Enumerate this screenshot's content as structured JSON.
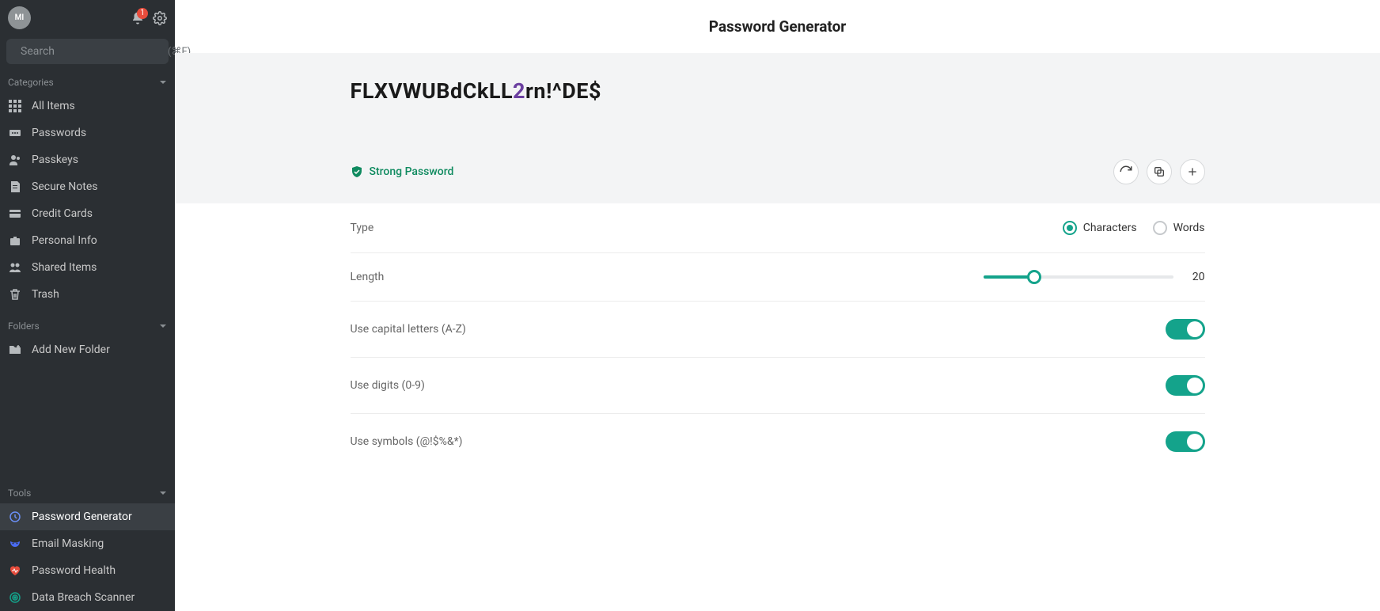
{
  "header": {
    "avatar_initials": "MI",
    "notification_count": "1",
    "search_placeholder": "Search",
    "search_hint": "(⌘F)"
  },
  "sidebar": {
    "categories_label": "Categories",
    "items": [
      {
        "label": "All Items"
      },
      {
        "label": "Passwords"
      },
      {
        "label": "Passkeys"
      },
      {
        "label": "Secure Notes"
      },
      {
        "label": "Credit Cards"
      },
      {
        "label": "Personal Info"
      },
      {
        "label": "Shared Items"
      },
      {
        "label": "Trash"
      }
    ],
    "folders_label": "Folders",
    "add_folder_label": "Add New Folder",
    "tools_label": "Tools",
    "tools": [
      {
        "label": "Password Generator"
      },
      {
        "label": "Email Masking"
      },
      {
        "label": "Password Health"
      },
      {
        "label": "Data Breach Scanner"
      }
    ]
  },
  "main": {
    "title": "Password Generator",
    "password_plain": "FLXVWUBdCkLL2rn!^DE$",
    "password_segments": [
      {
        "text": "FLXVWUBdCkLL",
        "kind": "alpha"
      },
      {
        "text": "2",
        "kind": "digit"
      },
      {
        "text": "rn",
        "kind": "alpha"
      },
      {
        "text": "!^",
        "kind": "symbol"
      },
      {
        "text": "DE",
        "kind": "alpha"
      },
      {
        "text": "$",
        "kind": "symbol"
      }
    ],
    "strength_label": "Strong Password",
    "type_label": "Type",
    "type_options": {
      "characters": "Characters",
      "words": "Words"
    },
    "type_selected": "characters",
    "length_label": "Length",
    "length_value": "20",
    "length_min": 4,
    "length_max": 64,
    "options": {
      "capitals": {
        "label": "Use capital letters (A-Z)",
        "on": true
      },
      "digits": {
        "label": "Use digits (0-9)",
        "on": true
      },
      "symbols": {
        "label": "Use symbols (@!$%&*)",
        "on": true
      }
    }
  },
  "colors": {
    "accent": "#14a38b"
  }
}
